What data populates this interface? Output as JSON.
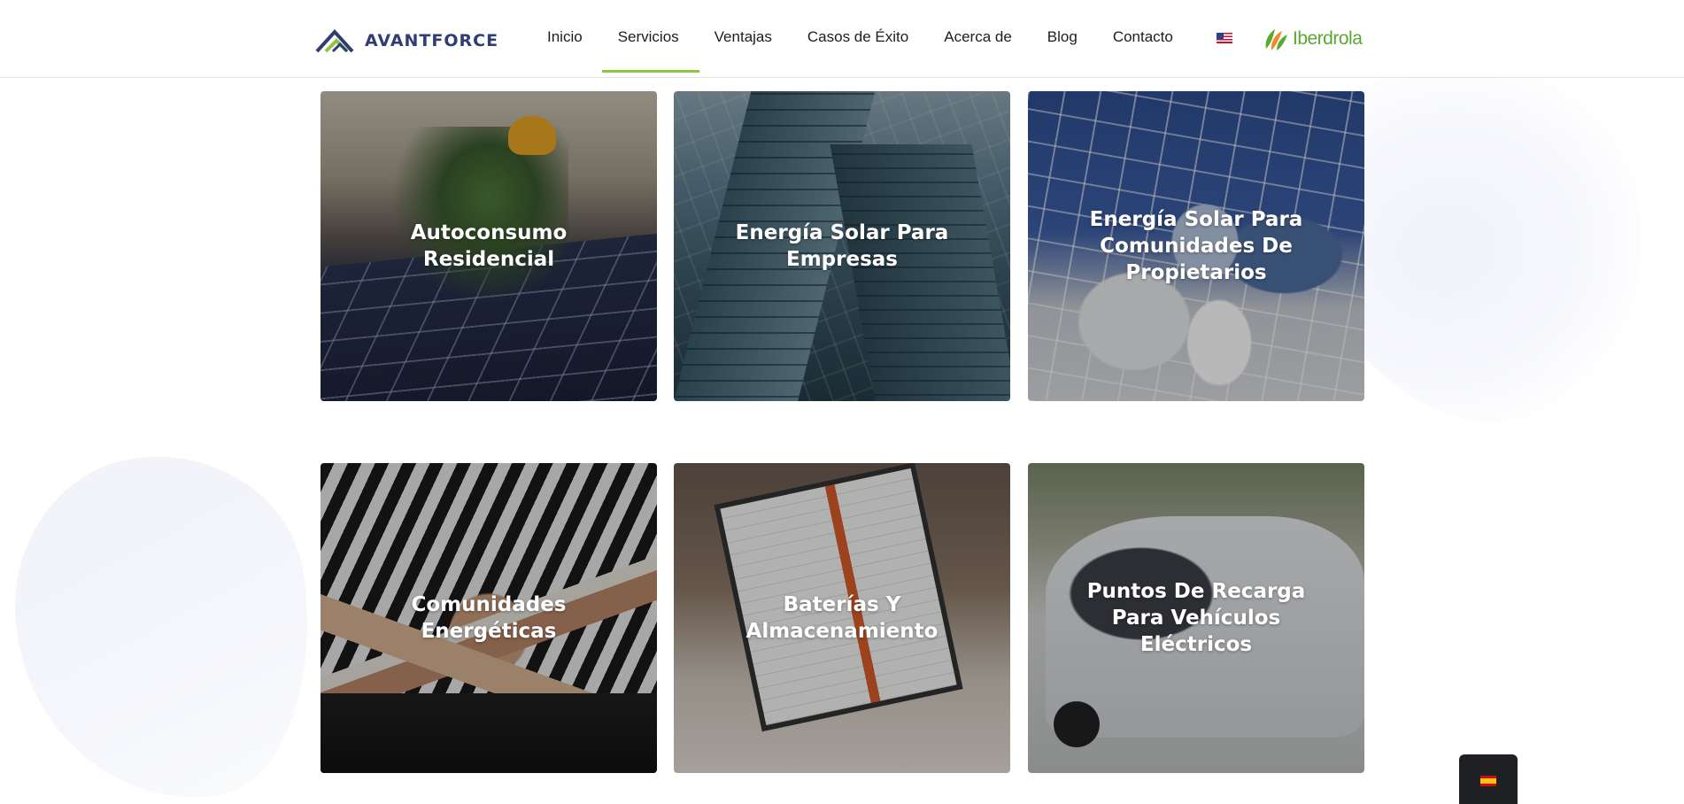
{
  "header": {
    "brand": "AVANTFORCE",
    "nav": [
      {
        "label": "Inicio"
      },
      {
        "label": "Servicios",
        "active": true
      },
      {
        "label": "Ventajas"
      },
      {
        "label": "Casos de Éxito"
      },
      {
        "label": "Acerca de"
      },
      {
        "label": "Blog"
      },
      {
        "label": "Contacto"
      }
    ],
    "language_flag_icon": "us-flag-icon",
    "partner_logo": "Iberdrola",
    "accent_color": "#8cc63f",
    "brand_color": "#2f3d74"
  },
  "services": [
    {
      "title": "Autoconsumo Residencial"
    },
    {
      "title": "Energía Solar Para Empresas"
    },
    {
      "title": "Energía Solar Para Comunidades De Propietarios"
    },
    {
      "title": "Comunidades Energéticas"
    },
    {
      "title": "Baterías Y Almacenamiento"
    },
    {
      "title": "Puntos De Recarga Para Vehículos Eléctricos"
    }
  ],
  "language_switcher": {
    "icon": "es-flag-icon"
  }
}
